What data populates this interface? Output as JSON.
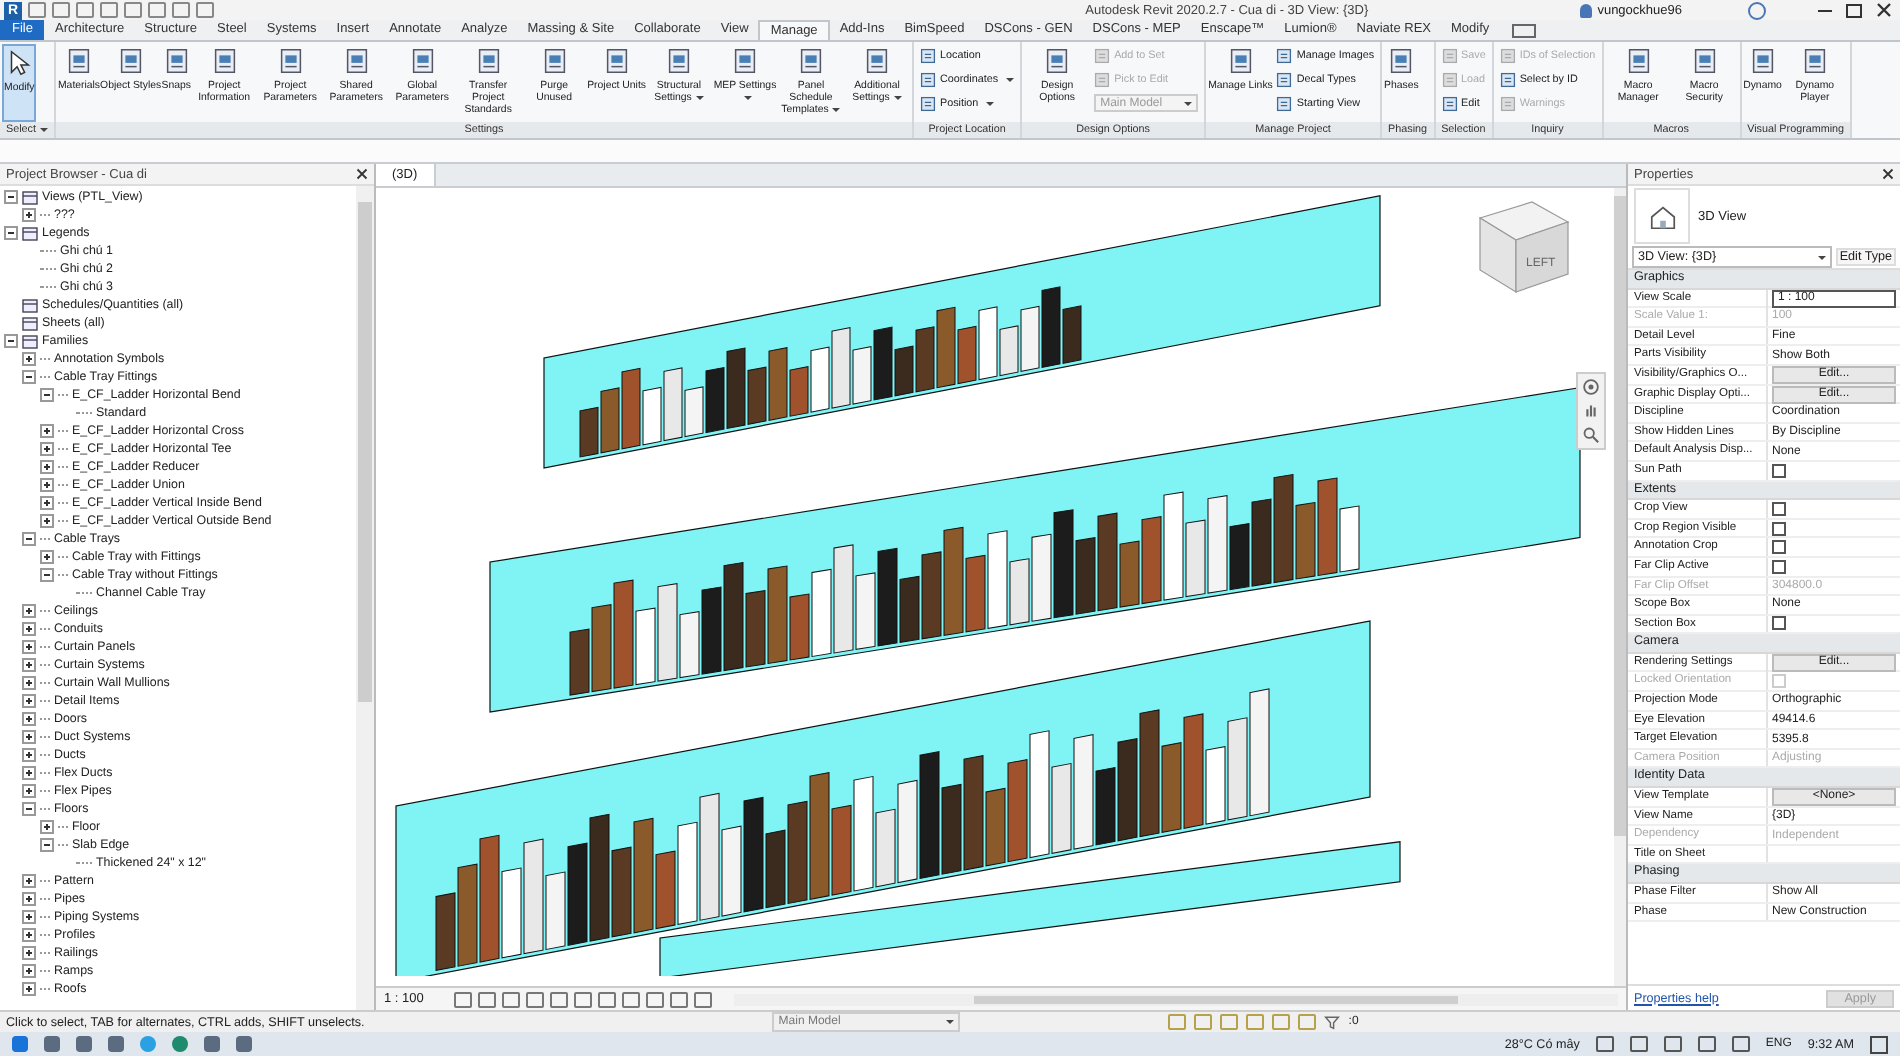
{
  "app": {
    "logo": "R",
    "title": "Autodesk Revit 2020.2.7 - Cua di - 3D View: {3D}",
    "user": "vungockhue96"
  },
  "ribbon_tabs": [
    {
      "label": "File",
      "kind": "file",
      "selected": false
    },
    {
      "label": "Architecture",
      "kind": "tab",
      "selected": false
    },
    {
      "label": "Structure",
      "kind": "tab",
      "selected": false
    },
    {
      "label": "Steel",
      "kind": "tab",
      "selected": false
    },
    {
      "label": "Systems",
      "kind": "tab",
      "selected": false
    },
    {
      "label": "Insert",
      "kind": "tab",
      "selected": false
    },
    {
      "label": "Annotate",
      "kind": "tab",
      "selected": false
    },
    {
      "label": "Analyze",
      "kind": "tab",
      "selected": false
    },
    {
      "label": "Massing & Site",
      "kind": "tab",
      "selected": false
    },
    {
      "label": "Collaborate",
      "kind": "tab",
      "selected": false
    },
    {
      "label": "View",
      "kind": "tab",
      "selected": false
    },
    {
      "label": "Manage",
      "kind": "tab",
      "selected": true
    },
    {
      "label": "Add-Ins",
      "kind": "tab",
      "selected": false
    },
    {
      "label": "BimSpeed",
      "kind": "tab",
      "selected": false
    },
    {
      "label": "DSCons - GEN",
      "kind": "tab",
      "selected": false
    },
    {
      "label": "DSCons - MEP",
      "kind": "tab",
      "selected": false
    },
    {
      "label": "Enscape™",
      "kind": "tab",
      "selected": false
    },
    {
      "label": "Lumion®",
      "kind": "tab",
      "selected": false
    },
    {
      "label": "Naviate REX",
      "kind": "tab",
      "selected": false
    },
    {
      "label": "Modify",
      "kind": "tab",
      "selected": false
    }
  ],
  "ribbon_panels": [
    {
      "title": "Select",
      "dropdown": true,
      "groups": [
        {
          "kind": "large",
          "label": "Modify",
          "selected": true,
          "dropdown": false
        }
      ]
    },
    {
      "title": "Settings",
      "dropdown": false,
      "groups": [
        {
          "kind": "large",
          "label": "Materials",
          "selected": false,
          "dropdown": false
        },
        {
          "kind": "large",
          "label": "Object Styles",
          "selected": false,
          "dropdown": false
        },
        {
          "kind": "large",
          "label": "Snaps",
          "selected": false,
          "dropdown": false
        },
        {
          "kind": "large",
          "label": "Project Information",
          "selected": false,
          "dropdown": false
        },
        {
          "kind": "large",
          "label": "Project Parameters",
          "selected": false,
          "dropdown": false
        },
        {
          "kind": "large",
          "label": "Shared Parameters",
          "selected": false,
          "dropdown": false
        },
        {
          "kind": "large",
          "label": "Global Parameters",
          "selected": false,
          "dropdown": false
        },
        {
          "kind": "large",
          "label": "Transfer Project Standards",
          "selected": false,
          "dropdown": false
        },
        {
          "kind": "large",
          "label": "Purge Unused",
          "selected": false,
          "dropdown": false
        },
        {
          "kind": "large",
          "label": "Project Units",
          "selected": false,
          "dropdown": false
        },
        {
          "kind": "large",
          "label": "Structural Settings",
          "selected": false,
          "dropdown": true
        },
        {
          "kind": "large",
          "label": "MEP Settings",
          "selected": false,
          "dropdown": true
        },
        {
          "kind": "large",
          "label": "Panel Schedule Templates",
          "selected": false,
          "dropdown": true
        },
        {
          "kind": "large",
          "label": "Additional Settings",
          "selected": false,
          "dropdown": true
        }
      ]
    },
    {
      "title": "Project Location",
      "dropdown": false,
      "groups": [
        {
          "kind": "stack",
          "items": [
            {
              "kind": "tool",
              "label": "Location",
              "disabled": false,
              "dropdown": false
            },
            {
              "kind": "tool",
              "label": "Coordinates",
              "disabled": false,
              "dropdown": true
            },
            {
              "kind": "tool",
              "label": "Position",
              "disabled": false,
              "dropdown": true
            }
          ]
        }
      ]
    },
    {
      "title": "Design Options",
      "dropdown": false,
      "groups": [
        {
          "kind": "large",
          "label": "Design Options",
          "selected": false,
          "dropdown": false
        },
        {
          "kind": "stack",
          "items": [
            {
              "kind": "tool",
              "label": "Add to Set",
              "disabled": true,
              "dropdown": false
            },
            {
              "kind": "tool",
              "label": "Pick to Edit",
              "disabled": true,
              "dropdown": false
            },
            {
              "kind": "combo",
              "label": "Main Model",
              "disabled": true,
              "dropdown": true
            }
          ]
        }
      ]
    },
    {
      "title": "Manage Project",
      "dropdown": false,
      "groups": [
        {
          "kind": "large",
          "label": "Manage Links",
          "selected": false,
          "dropdown": false
        },
        {
          "kind": "stack",
          "items": [
            {
              "kind": "tool",
              "label": "Manage Images",
              "disabled": false,
              "dropdown": false
            },
            {
              "kind": "tool",
              "label": "Decal Types",
              "disabled": false,
              "dropdown": false
            },
            {
              "kind": "tool",
              "label": "Starting View",
              "disabled": false,
              "dropdown": false
            }
          ]
        }
      ]
    },
    {
      "title": "Phasing",
      "dropdown": false,
      "groups": [
        {
          "kind": "large",
          "label": "Phases",
          "selected": false,
          "dropdown": false
        }
      ]
    },
    {
      "title": "Selection",
      "dropdown": false,
      "groups": [
        {
          "kind": "stack",
          "items": [
            {
              "kind": "tool",
              "label": "Save",
              "disabled": true,
              "dropdown": false
            },
            {
              "kind": "tool",
              "label": "Load",
              "disabled": true,
              "dropdown": false
            },
            {
              "kind": "tool",
              "label": "Edit",
              "disabled": false,
              "dropdown": false
            }
          ]
        }
      ]
    },
    {
      "title": "Inquiry",
      "dropdown": false,
      "groups": [
        {
          "kind": "stack",
          "items": [
            {
              "kind": "tool",
              "label": "IDs of Selection",
              "disabled": true,
              "dropdown": false
            },
            {
              "kind": "tool",
              "label": "Select by ID",
              "disabled": false,
              "dropdown": false
            },
            {
              "kind": "tool",
              "label": "Warnings",
              "disabled": true,
              "dropdown": false
            }
          ]
        }
      ]
    },
    {
      "title": "Macros",
      "dropdown": false,
      "groups": [
        {
          "kind": "large",
          "label": "Macro Manager",
          "selected": false,
          "dropdown": false
        },
        {
          "kind": "large",
          "label": "Macro Security",
          "selected": false,
          "dropdown": false
        }
      ]
    },
    {
      "title": "Visual Programming",
      "dropdown": false,
      "groups": [
        {
          "kind": "large",
          "label": "Dynamo",
          "selected": false,
          "dropdown": false
        },
        {
          "kind": "large",
          "label": "Dynamo Player",
          "selected": false,
          "dropdown": false
        }
      ]
    }
  ],
  "project_browser": {
    "title": "Project Browser - Cua di",
    "tree": [
      {
        "kind": "group",
        "label": "Views (PTL_View)",
        "expanded": true,
        "children": [
          {
            "kind": "group",
            "label": "???",
            "expanded": false
          }
        ]
      },
      {
        "kind": "group",
        "label": "Legends",
        "expanded": true,
        "children": [
          {
            "kind": "leaf",
            "label": "Ghi chú 1"
          },
          {
            "kind": "leaf",
            "label": "Ghi chú 2"
          },
          {
            "kind": "leaf",
            "label": "Ghi chú 3"
          }
        ]
      },
      {
        "kind": "leaf",
        "label": "Schedules/Quantities (all)"
      },
      {
        "kind": "leaf",
        "label": "Sheets (all)"
      },
      {
        "kind": "group",
        "label": "Families",
        "expanded": true,
        "children": [
          {
            "kind": "group",
            "label": "Annotation Symbols",
            "expanded": false
          },
          {
            "kind": "group",
            "label": "Cable Tray Fittings",
            "expanded": true,
            "children": [
              {
                "kind": "group",
                "label": "E_CF_Ladder Horizontal Bend",
                "expanded": true,
                "children": [
                  {
                    "kind": "leaf",
                    "label": "Standard"
                  }
                ]
              },
              {
                "kind": "group",
                "label": "E_CF_Ladder Horizontal Cross",
                "expanded": false
              },
              {
                "kind": "group",
                "label": "E_CF_Ladder Horizontal Tee",
                "expanded": false
              },
              {
                "kind": "group",
                "label": "E_CF_Ladder Reducer",
                "expanded": false
              },
              {
                "kind": "group",
                "label": "E_CF_Ladder Union",
                "expanded": false
              },
              {
                "kind": "group",
                "label": "E_CF_Ladder Vertical Inside Bend",
                "expanded": false
              },
              {
                "kind": "group",
                "label": "E_CF_Ladder Vertical Outside Bend",
                "expanded": false
              }
            ]
          },
          {
            "kind": "group",
            "label": "Cable Trays",
            "expanded": true,
            "children": [
              {
                "kind": "group",
                "label": "Cable Tray with Fittings",
                "expanded": false
              },
              {
                "kind": "group",
                "label": "Cable Tray without Fittings",
                "expanded": true,
                "children": [
                  {
                    "kind": "leaf",
                    "label": "Channel Cable Tray"
                  }
                ]
              }
            ]
          },
          {
            "kind": "group",
            "label": "Ceilings",
            "expanded": false
          },
          {
            "kind": "group",
            "label": "Conduits",
            "expanded": false
          },
          {
            "kind": "group",
            "label": "Curtain Panels",
            "expanded": false
          },
          {
            "kind": "group",
            "label": "Curtain Systems",
            "expanded": false
          },
          {
            "kind": "group",
            "label": "Curtain Wall Mullions",
            "expanded": false
          },
          {
            "kind": "group",
            "label": "Detail Items",
            "expanded": false
          },
          {
            "kind": "group",
            "label": "Doors",
            "expanded": false
          },
          {
            "kind": "group",
            "label": "Duct Systems",
            "expanded": false
          },
          {
            "kind": "group",
            "label": "Ducts",
            "expanded": false
          },
          {
            "kind": "group",
            "label": "Flex Ducts",
            "expanded": false
          },
          {
            "kind": "group",
            "label": "Flex Pipes",
            "expanded": false
          },
          {
            "kind": "group",
            "label": "Floors",
            "expanded": true,
            "children": [
              {
                "kind": "group",
                "label": "Floor",
                "expanded": false
              },
              {
                "kind": "group",
                "label": "Slab Edge",
                "expanded": true,
                "children": [
                  {
                    "kind": "leaf",
                    "label": "Thickened 24\" x 12\""
                  }
                ]
              }
            ]
          },
          {
            "kind": "group",
            "label": "Pattern",
            "expanded": false
          },
          {
            "kind": "group",
            "label": "Pipes",
            "expanded": false
          },
          {
            "kind": "group",
            "label": "Piping Systems",
            "expanded": false
          },
          {
            "kind": "group",
            "label": "Profiles",
            "expanded": false
          },
          {
            "kind": "group",
            "label": "Railings",
            "expanded": false
          },
          {
            "kind": "group",
            "label": "Ramps",
            "expanded": false
          },
          {
            "kind": "group",
            "label": "Roofs",
            "expanded": false
          }
        ]
      }
    ]
  },
  "view": {
    "tab": "(3D)",
    "cube_face": "LEFT",
    "scale": "1 : 100"
  },
  "properties": {
    "title": "Properties",
    "type_name": "3D View",
    "selector": "3D View: {3D}",
    "edit_type": "Edit Type",
    "sections": [
      {
        "title": "Graphics",
        "rows": [
          {
            "label": "View Scale",
            "value": "1 : 100",
            "kind": "input",
            "disabled": false
          },
          {
            "label": "Scale Value    1:",
            "value": "100",
            "kind": "text",
            "disabled": true
          },
          {
            "label": "Detail Level",
            "value": "Fine",
            "kind": "text",
            "disabled": false
          },
          {
            "label": "Parts Visibility",
            "value": "Show Both",
            "kind": "text",
            "disabled": false
          },
          {
            "label": "Visibility/Graphics O...",
            "value": "Edit...",
            "kind": "button",
            "disabled": false
          },
          {
            "label": "Graphic Display Opti...",
            "value": "Edit...",
            "kind": "button",
            "disabled": false
          },
          {
            "label": "Discipline",
            "value": "Coordination",
            "kind": "text",
            "disabled": false
          },
          {
            "label": "Show Hidden Lines",
            "value": "By Discipline",
            "kind": "text",
            "disabled": false
          },
          {
            "label": "Default Analysis Disp...",
            "value": "None",
            "kind": "text",
            "disabled": false
          },
          {
            "label": "Sun Path",
            "kind": "checkbox",
            "checked": false,
            "disabled": false
          }
        ]
      },
      {
        "title": "Extents",
        "rows": [
          {
            "label": "Crop View",
            "kind": "checkbox",
            "checked": false,
            "disabled": false
          },
          {
            "label": "Crop Region Visible",
            "kind": "checkbox",
            "checked": false,
            "disabled": false
          },
          {
            "label": "Annotation Crop",
            "kind": "checkbox",
            "checked": false,
            "disabled": false
          },
          {
            "label": "Far Clip Active",
            "kind": "checkbox",
            "checked": false,
            "disabled": false
          },
          {
            "label": "Far Clip Offset",
            "value": "304800.0",
            "kind": "text",
            "disabled": true
          },
          {
            "label": "Scope Box",
            "value": "None",
            "kind": "text",
            "disabled": false
          },
          {
            "label": "Section Box",
            "kind": "checkbox",
            "checked": false,
            "disabled": false
          }
        ]
      },
      {
        "title": "Camera",
        "rows": [
          {
            "label": "Rendering Settings",
            "value": "Edit...",
            "kind": "button",
            "disabled": false
          },
          {
            "label": "Locked Orientation",
            "kind": "checkbox",
            "checked": false,
            "disabled": true
          },
          {
            "label": "Projection Mode",
            "value": "Orthographic",
            "kind": "text",
            "disabled": false
          },
          {
            "label": "Eye Elevation",
            "value": "49414.6",
            "kind": "text",
            "disabled": false
          },
          {
            "label": "Target Elevation",
            "value": "5395.8",
            "kind": "text",
            "disabled": false
          },
          {
            "label": "Camera Position",
            "value": "Adjusting",
            "kind": "text",
            "disabled": true
          }
        ]
      },
      {
        "title": "Identity Data",
        "rows": [
          {
            "label": "View Template",
            "value": "<None>",
            "kind": "button",
            "disabled": false
          },
          {
            "label": "View Name",
            "value": "{3D}",
            "kind": "text",
            "disabled": false
          },
          {
            "label": "Dependency",
            "value": "Independent",
            "kind": "text",
            "disabled": true
          },
          {
            "label": "Title on Sheet",
            "kind": "text",
            "disabled": false
          }
        ]
      },
      {
        "title": "Phasing",
        "rows": [
          {
            "label": "Phase Filter",
            "value": "Show All",
            "kind": "text",
            "disabled": false
          },
          {
            "label": "Phase",
            "value": "New Construction",
            "kind": "text",
            "disabled": false
          }
        ]
      }
    ],
    "help": "Properties help",
    "apply": "Apply"
  },
  "status_bar": {
    "message": "Click to select, TAB for alternates, CTRL adds, SHIFT unselects.",
    "model": "Main Model",
    "filter_count": ":0"
  },
  "taskbar": {
    "weather": "28°C Có mây",
    "language": "ENG",
    "time": "9:32 AM"
  }
}
